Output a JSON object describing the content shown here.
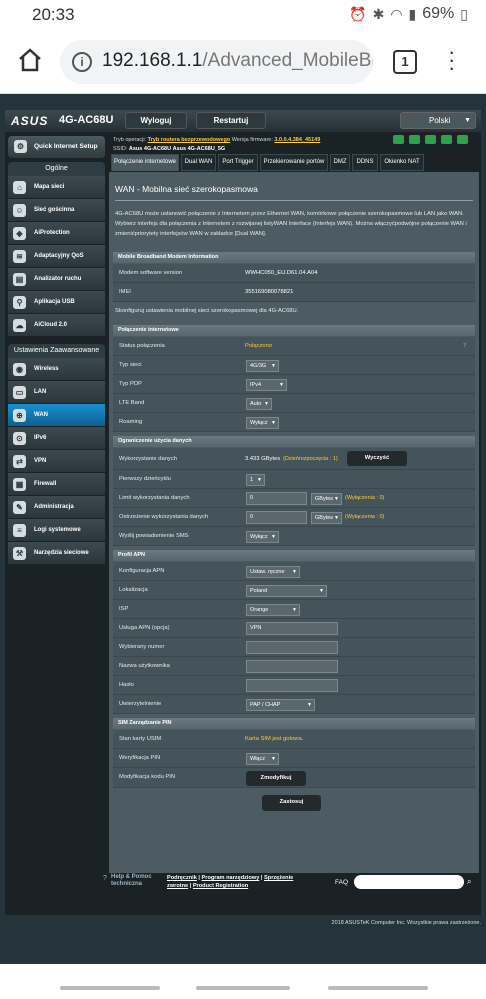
{
  "status": {
    "time": "20:33",
    "battery": "69%"
  },
  "browser": {
    "url_host": "192.168.1.1",
    "url_path": "/Advanced_MobileBroa",
    "tab_count": "1"
  },
  "router": {
    "logo": "ASUS",
    "model": "4G-AC68U",
    "logout": "Wyloguj",
    "restart": "Restartuj",
    "language": "Polski",
    "op_mode_label": "Tryb operacji:",
    "op_mode": "Tryb routera bezprzewodowego",
    "fw_label": "Wersja firmware:",
    "fw": "3.0.0.4.384_45149",
    "ssid_label": "SSID:",
    "ssid1": "Asus 4G-AC68U",
    "ssid2": "Asus 4G-AC68U_5G"
  },
  "sidebar": {
    "qis": "Quick Internet Setup",
    "general": "Ogólne",
    "general_items": [
      "Mapa sieci",
      "Sieć gościnna",
      "AiProtection",
      "Adaptacyjny QoS",
      "Analizator ruchu",
      "Aplikacja USB",
      "AiCloud 2.0"
    ],
    "advanced": "Ustawienia Zaawansowane",
    "advanced_items": [
      "Wireless",
      "LAN",
      "WAN",
      "IPv6",
      "VPN",
      "Firewall",
      "Administracja",
      "Logi systemowe",
      "Narzędzia sieciowe"
    ]
  },
  "tabs": [
    "Połączenie internetowe",
    "Dual WAN",
    "Port Trigger",
    "Przekierowanie portów",
    "DMZ",
    "DDNS",
    "Okienko NAT"
  ],
  "panel": {
    "title": "WAN - Mobilna sieć szerokopasmowa",
    "desc": "4G-AC68U może ustanowić połączenie z Internetem przez Ethernet WAN, komórkowe połączenie szerokopasmowe lub LAN jako WAN. Wybierz interfejs dla połączenia z Internetem z rozwijanej listyWAN Interface (Interfejs WAN). Można włączyćpodwójne połączenie WAN i zmienićpriorytety interfejsów WAN w zakładce [Dual WAN].",
    "modem_head": "Mobile Broadband Modem Information",
    "modem_sw_label": "Modem software version",
    "modem_sw": "WWHC050_EU.D61.04.A04",
    "imei_label": "IMEI",
    "imei": "355169080078821",
    "config_text": "Skonfiguruj ustawienia mobilnej sieci szerokopasmowej dla 4G-AC68U.",
    "conn_head": "Połączenie internetowe",
    "conn_status_label": "Status połączenia",
    "conn_status": "Połączono",
    "conn_help": "?",
    "net_type_label": "Typ sieci",
    "net_type": "4G/3G",
    "pdp_label": "Typ PDP",
    "pdp": "IPv4",
    "lte_label": "LTE Band",
    "lte": "Auto",
    "roaming_label": "Roaming",
    "roaming": "Wyłącz",
    "limit_head": "Ograniczenie użycia danych",
    "usage_label": "Wykorzystanie danych",
    "usage": "3.433 GBytes",
    "usage_since": "(Dzieńrozpoczęcia : 1)",
    "clear_btn": "Wyczyść",
    "first_day_label": "Pierwszy dzieńcyklu",
    "first_day": "1",
    "limit_label": "Limit wykorzystania danych",
    "limit_value": "0",
    "limit_unit": "GBytes",
    "limit_hint": "(Wyłączenia : 0)",
    "warn_label": "Ostrzeżenie wykorzystania danych",
    "warn_value": "0",
    "warn_unit": "GBytes",
    "warn_hint": "(Wyłączenia : 0)",
    "sms_label": "Wyślij powiadomienie SMS",
    "sms": "Wyłącz",
    "apn_head": "Profil APN",
    "apn_cfg_label": "Konfiguracja APN",
    "apn_cfg": "Ustaw. ręczne",
    "loc_label": "Lokalizacja",
    "loc": "Poland",
    "isp_label": "ISP",
    "isp": "Orange",
    "apn_label": "Usługa APN (opcja)",
    "apn": "VPN",
    "dial_label": "Wybierany numer",
    "dial": "",
    "user_label": "Nazwa użytkownika",
    "user": "",
    "pass_label": "Hasło",
    "pass": "",
    "auth_label": "Uwierzytelnienie",
    "auth": "PAP / CHAP",
    "sim_head": "SIM Zarządzanie PIN",
    "usim_label": "Stan karty USIM",
    "usim": "Karta SIM jest gotowa.",
    "pinverify_label": "Weryfikacja PIN",
    "pinverify": "Włącz",
    "pinmod_label": "Modyfikacja kodu PIN",
    "pinmod_btn": "Zmodyfikuj",
    "apply_btn": "Zastosuj"
  },
  "footer": {
    "help1": "Help & Pomoc",
    "help2": "techniczna",
    "links_line1a": "Podręcznik",
    "links_sep": " | ",
    "links_line1b": "Program narzędziowy",
    "links_line1c": "Sprzężenie",
    "links_line2a": "zwrotne",
    "links_line2b": "Product Registration",
    "faq": "FAQ",
    "copyright": "2018 ASUSTeK Computer Inc. Wszystkie prawa zastrzeżone."
  }
}
